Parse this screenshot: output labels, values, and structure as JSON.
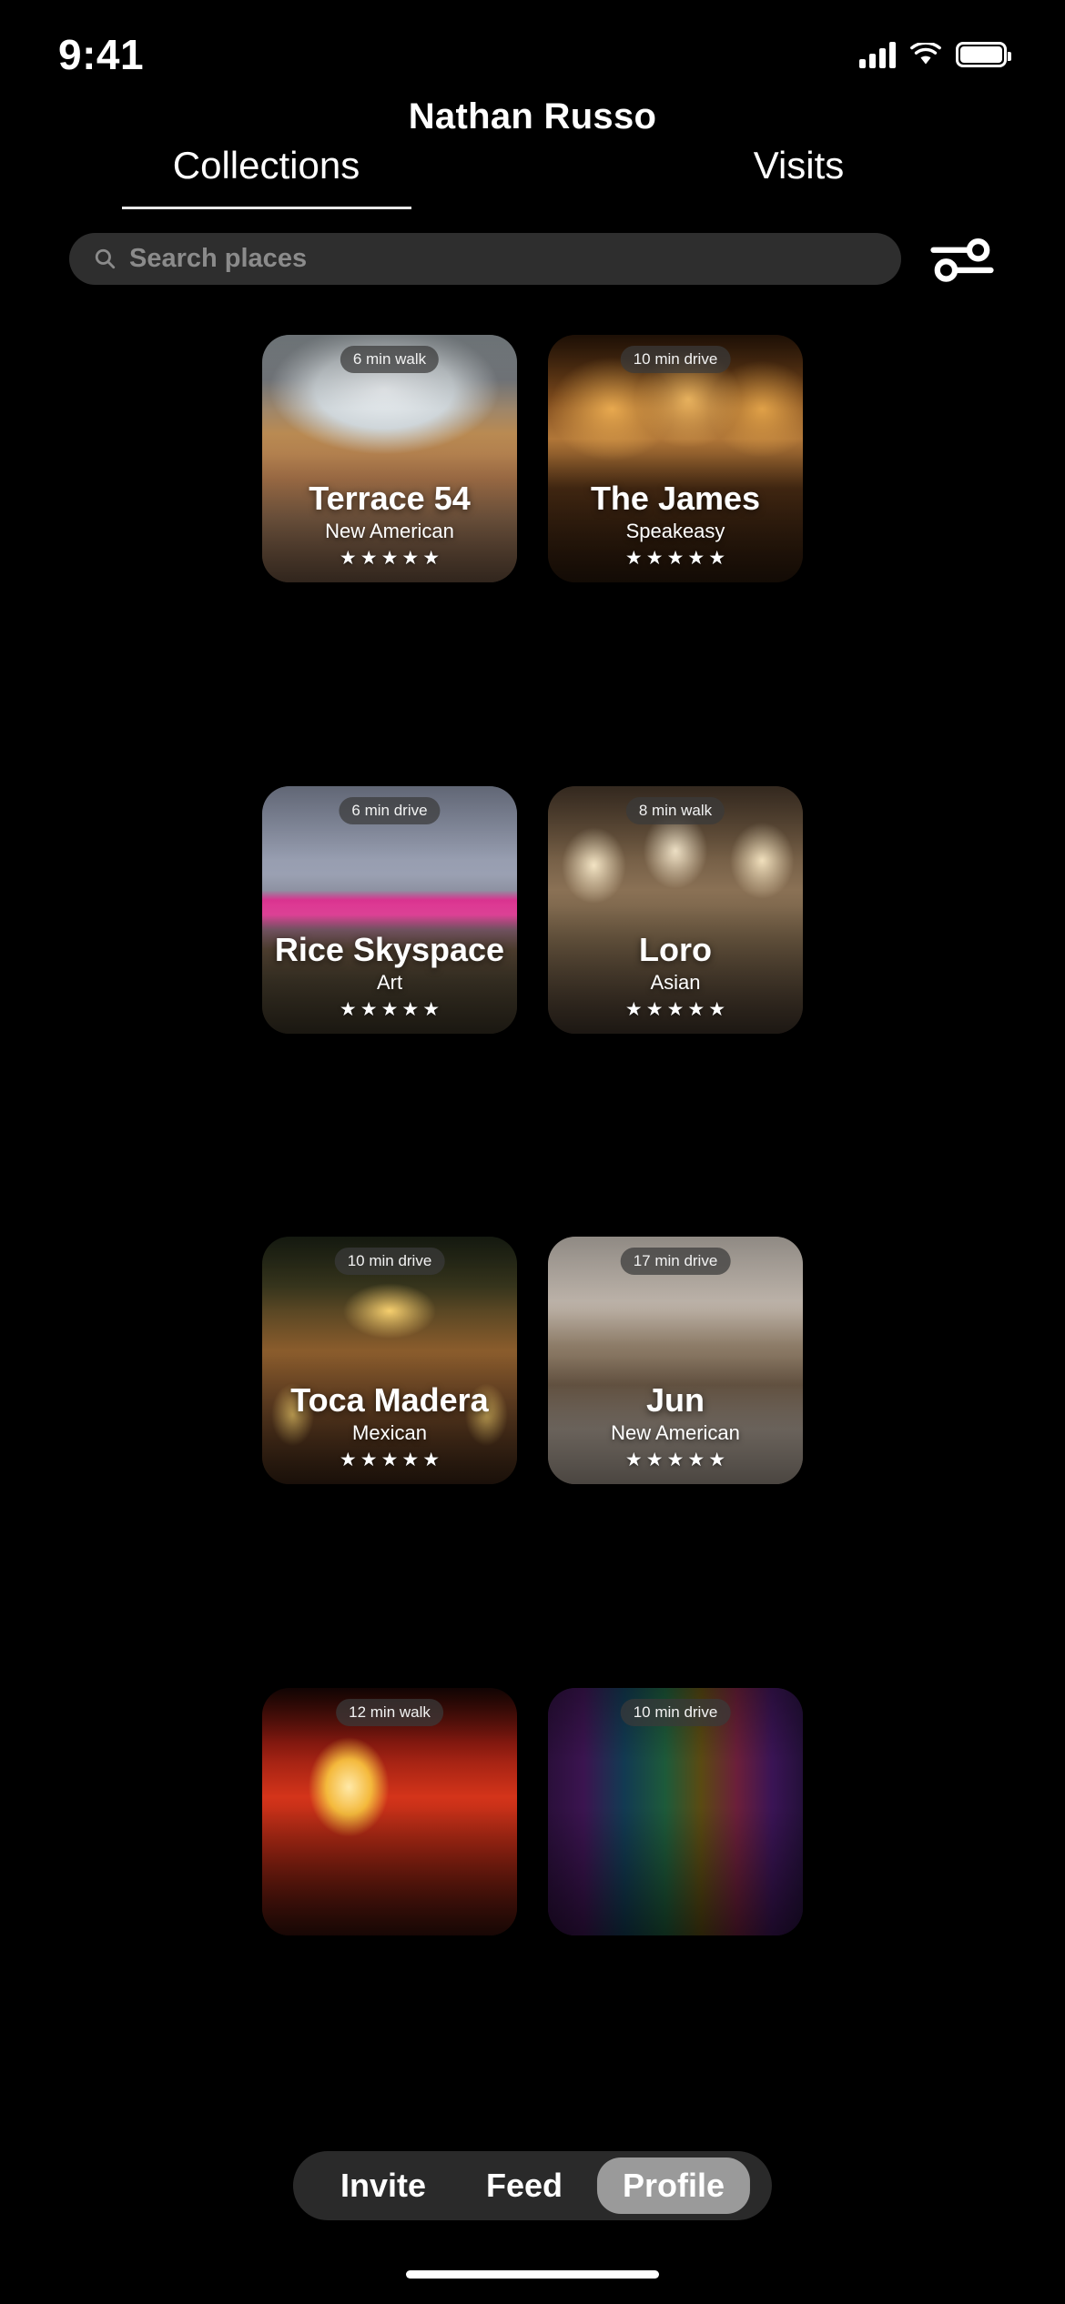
{
  "status_bar": {
    "time": "9:41",
    "cellular_icon": "signal-bars-icon",
    "wifi_icon": "wifi-icon",
    "battery_icon": "battery-icon"
  },
  "header": {
    "title": "Nathan Russo"
  },
  "tabs": [
    {
      "label": "Collections",
      "active": true
    },
    {
      "label": "Visits",
      "active": false
    }
  ],
  "search": {
    "placeholder": "Search places",
    "value": "",
    "icon": "search-icon",
    "filter_icon": "filter-sliders-icon"
  },
  "colors": {
    "background": "#000000",
    "search_field": "#2e2e2e",
    "placeholder_text": "#8b8b8b",
    "tab_indicator": "#e8e8e8",
    "badge_background": "rgba(58,58,58,0.72)",
    "tabbar_background": "rgba(46,46,46,0.92)",
    "tabbar_active_pill": "#9a9a9a",
    "text_primary": "#ffffff"
  },
  "places": [
    {
      "name": "Terrace 54",
      "category": "New American",
      "travel": "6 min walk",
      "rating": 5,
      "scene": "p-terrace"
    },
    {
      "name": "The James",
      "category": "Speakeasy",
      "travel": "10 min drive",
      "rating": 5,
      "scene": "p-james"
    },
    {
      "name": "Rice Skyspace",
      "category": "Art",
      "travel": "6 min drive",
      "rating": 5,
      "scene": "p-rice"
    },
    {
      "name": "Loro",
      "category": "Asian",
      "travel": "8 min walk",
      "rating": 5,
      "scene": "p-loro"
    },
    {
      "name": "Toca Madera",
      "category": "Mexican",
      "travel": "10 min drive",
      "rating": 5,
      "scene": "p-toca"
    },
    {
      "name": "Jun",
      "category": "New American",
      "travel": "17 min drive",
      "rating": 5,
      "scene": "p-jun"
    },
    {
      "name": "",
      "category": "",
      "travel": "12 min walk",
      "rating": 0,
      "scene": "p-red"
    },
    {
      "name": "",
      "category": "",
      "travel": "10 min drive",
      "rating": 0,
      "scene": "p-neon"
    }
  ],
  "bottom_bar": [
    {
      "label": "Invite",
      "active": false
    },
    {
      "label": "Feed",
      "active": false
    },
    {
      "label": "Profile",
      "active": true
    }
  ]
}
